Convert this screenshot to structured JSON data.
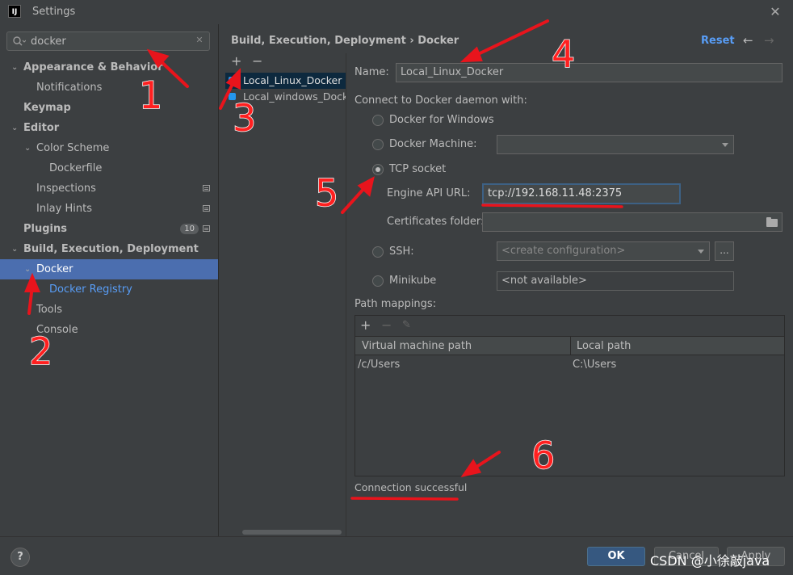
{
  "window": {
    "title": "Settings",
    "logo_text": "IJ"
  },
  "search": {
    "value": "docker",
    "placeholder": ""
  },
  "tree": [
    {
      "label": "Appearance & Behavior",
      "level": 0,
      "expanded": true,
      "bold": true
    },
    {
      "label": "Notifications",
      "level": 1
    },
    {
      "label": "Keymap",
      "level": 0,
      "bold": true
    },
    {
      "label": "Editor",
      "level": 0,
      "expanded": true,
      "bold": true
    },
    {
      "label": "Color Scheme",
      "level": 1,
      "expanded": true
    },
    {
      "label": "Dockerfile",
      "level": 2
    },
    {
      "label": "Inspections",
      "level": 1,
      "settings": true
    },
    {
      "label": "Inlay Hints",
      "level": 1,
      "settings": true
    },
    {
      "label": "Plugins",
      "level": 0,
      "bold": true,
      "badge": "10",
      "settings": true
    },
    {
      "label": "Build, Execution, Deployment",
      "level": 0,
      "expanded": true,
      "bold": true
    },
    {
      "label": "Docker",
      "level": 1,
      "expanded": true,
      "selected": true
    },
    {
      "label": "Docker Registry",
      "level": 2,
      "link": true
    },
    {
      "label": "Tools",
      "level": 1
    },
    {
      "label": "Console",
      "level": 1
    }
  ],
  "header": {
    "breadcrumb": "Build, Execution, Deployment  ›  Docker",
    "reset": "Reset",
    "back_icon": "←",
    "forward_icon": "→"
  },
  "servers": {
    "add_icon": "+",
    "remove_icon": "−",
    "items": [
      {
        "label": "Local_Linux_Docker",
        "selected": true
      },
      {
        "label": "Local_windows_Docker",
        "selected": false
      }
    ]
  },
  "form": {
    "name_label": "Name:",
    "name_value": "Local_Linux_Docker",
    "connect_label": "Connect to Docker daemon with:",
    "opt_windows": "Docker for Windows",
    "opt_machine": "Docker Machine:",
    "opt_tcp": "TCP socket",
    "engine_label": "Engine API URL:",
    "engine_value": "tcp://192.168.11.48:2375",
    "certs_label": "Certificates folder:",
    "opt_ssh": "SSH:",
    "ssh_value": "<create configuration>",
    "ssh_more": "...",
    "opt_minikube": "Minikube",
    "minikube_value": "<not available>"
  },
  "mappings": {
    "label": "Path mappings:",
    "add_icon": "+",
    "remove_icon": "−",
    "edit_icon": "✎",
    "columns": [
      "Virtual machine path",
      "Local path"
    ],
    "rows": [
      [
        "/c/Users",
        "C:\\Users"
      ]
    ]
  },
  "status": "Connection successful",
  "footer": {
    "help": "?",
    "ok": "OK",
    "cancel": "Cancel",
    "apply": "Apply"
  },
  "watermark": "CSDN @小徐敲java",
  "annotations": [
    "1",
    "2",
    "3",
    "4",
    "5",
    "6"
  ],
  "colors": {
    "selection": "#4b6eaf",
    "link": "#589df6",
    "annotation": "#ff2020"
  }
}
